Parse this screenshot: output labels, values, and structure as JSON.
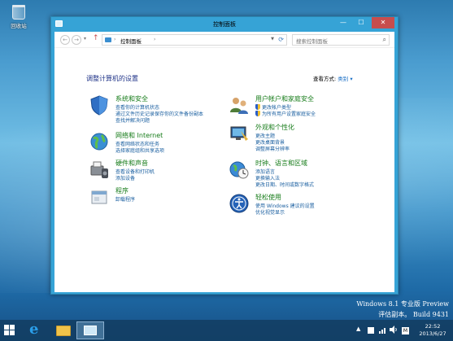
{
  "desktop": {
    "recycle_bin_label": "回收站"
  },
  "window": {
    "title": "控制面板",
    "minimize": "—",
    "maximize": "☐",
    "close": "✕"
  },
  "nav": {
    "back": "←",
    "forward": "→",
    "recent": "▾",
    "up": "↑",
    "breadcrumb_separator": "›",
    "breadcrumb": "控制面板",
    "dropdown": "▼",
    "refresh": "⟳",
    "search_placeholder": "搜索控制面板",
    "search_icon": "⌕"
  },
  "content": {
    "heading": "调整计算机的设置",
    "view_by_label": "查看方式:",
    "view_by_value": "类别 ▾"
  },
  "categories": [
    {
      "icon": "system-security-icon",
      "title": "系统和安全",
      "links": [
        "查看你的计算机状态",
        "通过文件历史记录保存你的文件备份副本",
        "查找并解决问题"
      ]
    },
    {
      "icon": "network-internet-icon",
      "title": "网络和 Internet",
      "links": [
        "查看网络状态和任务",
        "选择家庭组和共享选项"
      ]
    },
    {
      "icon": "hardware-sound-icon",
      "title": "硬件和声音",
      "links": [
        "查看设备和打印机",
        "添加设备"
      ]
    },
    {
      "icon": "programs-icon",
      "title": "程序",
      "links": [
        "卸载程序"
      ]
    },
    {
      "icon": "user-accounts-icon",
      "title": "用户帐户和家庭安全",
      "links": [
        "更改帐户类型",
        "为所有用户设置家庭安全"
      ]
    },
    {
      "icon": "appearance-icon",
      "title": "外观和个性化",
      "links": [
        "更改主题",
        "更改桌面背景",
        "调整屏幕分辨率"
      ]
    },
    {
      "icon": "clock-region-icon",
      "title": "时钟、语言和区域",
      "links": [
        "添加语言",
        "更换输入法",
        "更改日期、时间或数字格式"
      ]
    },
    {
      "icon": "ease-of-access-icon",
      "title": "轻松使用",
      "links": [
        "使用 Windows 建议的设置",
        "优化视觉显示"
      ]
    }
  ],
  "watermark": {
    "line1": "Windows 8.1 专业版 Preview",
    "line2": "评估副本。 Build 9431"
  },
  "taskbar": {
    "tray_expand": "▲",
    "ime": "M",
    "time": "22:52",
    "date": "2013/6/27"
  }
}
